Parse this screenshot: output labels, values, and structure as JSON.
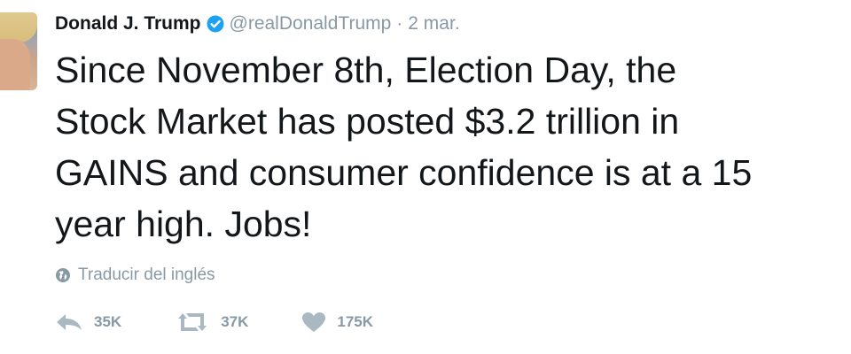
{
  "author": {
    "name": "Donald J. Trump",
    "handle": "@realDonaldTrump",
    "separator": "·",
    "time": "2 mar."
  },
  "tweet": {
    "text": "Since November 8th, Election Day, the\nStock Market has posted $3.2 trillion in\nGAINS and consumer confidence is at a 15\nyear high. Jobs!"
  },
  "translate": {
    "label": "Traducir del inglés",
    "icon": "globe-icon"
  },
  "actions": {
    "reply": {
      "icon": "reply-icon",
      "count": "35K"
    },
    "retweet": {
      "icon": "retweet-icon",
      "count": "37K"
    },
    "like": {
      "icon": "heart-icon",
      "count": "175K"
    }
  },
  "colors": {
    "text": "#14171a",
    "muted": "#8899a6",
    "verified": "#1da1f2",
    "icon": "#aab8c2"
  }
}
